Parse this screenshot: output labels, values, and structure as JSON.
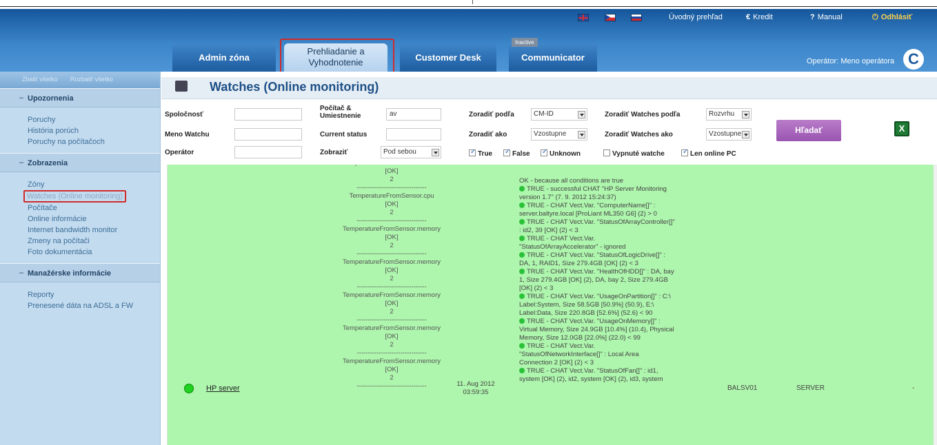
{
  "header": {
    "flags": [
      "uk-flag-icon",
      "cz-flag-icon",
      "sk-flag-icon"
    ],
    "links": {
      "overview": "Úvodný prehľad",
      "credit_sym": "€",
      "credit": "Kredit",
      "manual_sym": "?",
      "manual": "Manual",
      "logout_sym": "⏻",
      "logout": "Odhlásiť"
    },
    "tabs": {
      "admin": "Admin zóna",
      "prehliadanie_l1": "Prehliadanie a",
      "prehliadanie_l2": "Vyhodnotenie",
      "customer": "Customer Desk",
      "communicator": "Communicator",
      "inactive_badge": "Inactive"
    },
    "operator": "Operátor: Meno operátora",
    "logo": "C"
  },
  "sidebar": {
    "collapse_all": "Zbaliť všetko",
    "expand_all": "Rozbaliť všetko",
    "sections": [
      {
        "title": "Upozornenia",
        "items": [
          "Poruchy",
          "História porúch",
          "Poruchy na počítačoch"
        ]
      },
      {
        "title": "Zobrazenia",
        "items": [
          "Zóny",
          "Watches (Online monitoring)",
          "Počítače",
          "Online informácie",
          "Internet bandwidth monitor",
          "Zmeny na počítači",
          "Foto dokumentácia"
        ]
      },
      {
        "title": "Manažérske informácie",
        "items": [
          "Reporty",
          "Prenesené dáta na ADSL a FW"
        ]
      }
    ]
  },
  "page": {
    "title": "Watches (Online monitoring)"
  },
  "filter": {
    "company_label": "Spoločnosť",
    "company_value": "",
    "watch_name_label": "Meno Watchu",
    "watch_name_value": "",
    "operator_label": "Operátor",
    "operator_value": "",
    "pc_label_l1": "Počítač &",
    "pc_label_l2": "Umiestnenie",
    "pc_value": "av",
    "current_status_label": "Current status",
    "current_status_value": "",
    "show_label": "Zobraziť",
    "show_value": "Pod sebou",
    "sort_by_label": "Zoradiť podľa",
    "sort_by_value": "CM-ID",
    "sort_as_label": "Zoradiť ako",
    "sort_as_value": "Vzostupne",
    "sort_watches_by_label": "Zoradiť Watches podľa",
    "sort_watches_by_value": "Rozvrhu",
    "sort_watches_as_label": "Zoradiť Watches ako",
    "sort_watches_as_value": "Vzostupne",
    "check_true": "True",
    "check_false": "False",
    "check_unknown": "Unknown",
    "check_disabled": "Vypnuté watche",
    "check_online": "Len online PC",
    "search_button": "Hľadať"
  },
  "results": {
    "sensor_lines": [
      "Temperature FromSensor.chassis",
      "[OK]",
      "2",
      "--------------------------------",
      "TemperatureFromSensor.cpu",
      "[OK]",
      "2",
      "--------------------------------",
      "TemperatureFromSensor.memory",
      "[OK]",
      "2",
      "--------------------------------",
      "TemperatureFromSensor.memory",
      "[OK]",
      "2",
      "--------------------------------",
      "TemperatureFromSensor.memory",
      "[OK]",
      "2",
      "--------------------------------",
      "TemperatureFromSensor.memory",
      "[OK]",
      "2",
      "--------------------------------",
      "TemperatureFromSensor.memory",
      "[OK]",
      "2",
      "--------------------------------"
    ],
    "status_lines": [
      {
        "dot": false,
        "text": "OK - because all conditions are true"
      },
      {
        "dot": true,
        "text": "TRUE - successful CHAT \"HP Server Monitoring"
      },
      {
        "dot": false,
        "text": "version 1.7\" (7. 9. 2012 15:24:37)"
      },
      {
        "dot": true,
        "text": "TRUE - CHAT Vect.Var. \"ComputerName[]\" :"
      },
      {
        "dot": false,
        "text": "server.baltyre.local [ProLiant ML350 G6] (2) > 0"
      },
      {
        "dot": true,
        "text": "TRUE - CHAT Vect.Var. \"StatusOfArrayController[]\""
      },
      {
        "dot": false,
        "text": ": id2, 39 [OK] (2) < 3"
      },
      {
        "dot": true,
        "text": "TRUE - CHAT Vect.Var."
      },
      {
        "dot": false,
        "text": "\"StatusOfArrayAccelerator\" - ignored"
      },
      {
        "dot": true,
        "text": "TRUE - CHAT Vect.Var. \"StatusOfLogicDrive[]\" :"
      },
      {
        "dot": false,
        "text": "DA, 1, RAID1, Size 279.4GB [OK] (2) < 3"
      },
      {
        "dot": true,
        "text": "TRUE - CHAT Vect.Var. \"HealthOfHDD[]\" : DA, bay"
      },
      {
        "dot": false,
        "text": "1, Size 279.4GB [OK] (2), DA, bay 2, Size 279.4GB"
      },
      {
        "dot": false,
        "text": "[OK] (2) < 3"
      },
      {
        "dot": true,
        "text": "TRUE - CHAT Vect.Var. \"UsageOnPartition[]\" : C:\\"
      },
      {
        "dot": false,
        "text": "Label:System, Size 58.5GB [50.9%] (50.9), E:\\"
      },
      {
        "dot": false,
        "text": "Label:Data, Size 220.8GB [52.6%] (52.6) < 90"
      },
      {
        "dot": true,
        "text": "TRUE - CHAT Vect.Var. \"UsageOnMemory[]\" :"
      },
      {
        "dot": false,
        "text": "Virtual Memory, Size 24.9GB [10.4%] (10.4), Physical"
      },
      {
        "dot": false,
        "text": "Memory, Size 12.0GB [22.0%] (22.0) < 99"
      },
      {
        "dot": true,
        "text": "TRUE - CHAT Vect.Var."
      },
      {
        "dot": false,
        "text": "\"StatusOfNetworkInterface[]\" : Local Area"
      },
      {
        "dot": false,
        "text": "Connection 2 [OK] (2) < 3"
      },
      {
        "dot": true,
        "text": "TRUE - CHAT Vect.Var. \"StatusOfFan[]\" : id1,"
      },
      {
        "dot": false,
        "text": "system [OK] (2), id2, system [OK] (2), id3, system"
      }
    ],
    "row": {
      "name": "HP server",
      "date_l1": "11. Aug 2012",
      "date_l2": "03:59:35",
      "pc": "BALSV01",
      "type": "SERVER",
      "dash": "-"
    }
  }
}
